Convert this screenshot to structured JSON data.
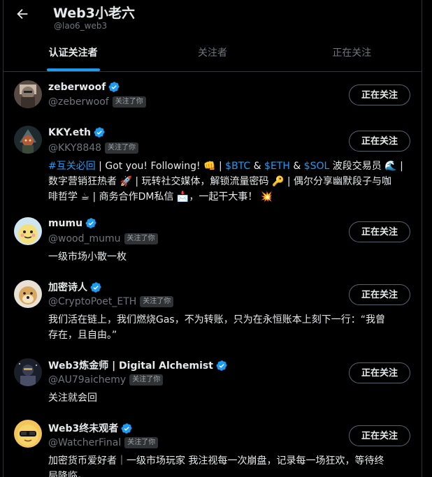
{
  "header": {
    "title": "Web3小老六",
    "handle": "@lao6_web3",
    "back_icon": "arrow-left-icon"
  },
  "tabs": [
    {
      "label": "认证关注者",
      "active": true
    },
    {
      "label": "关注者",
      "active": false
    },
    {
      "label": "正在关注",
      "active": false
    }
  ],
  "users": [
    {
      "name": "zeberwoof",
      "handle": "@zeberwoof",
      "badge": "关注了你",
      "button": "正在关注",
      "bio": []
    },
    {
      "name": "KKY.eth",
      "handle": "@KKY8848",
      "badge": "关注了你",
      "button": "正在关注",
      "bio": [
        "#互关必回 | Got you! Following! 👊 | $BTC & $ETH & $SOL 波段交易员 🌊 |",
        "数字营销狂热者 🚀 | 玩转社交媒体，解锁流量密码 🔑 | 偶尔分享幽默段子与咖",
        "啡哲学 ☕ | 商务合作DM私信 📩，一起干大事！ 💥"
      ]
    },
    {
      "name": "mumu",
      "handle": "@wood_mumu",
      "badge": "关注了你",
      "button": "正在关注",
      "bio": [
        "一级市场小散一枚"
      ]
    },
    {
      "name": "加密诗人",
      "handle": "@CryptoPoet_ETH",
      "badge": "关注了你",
      "button": "正在关注",
      "bio": [
        "我们活在链上，我们燃烧Gas，不为转账，只为在永恒账本上刻下一行：“我曾",
        "存在，且自由。”"
      ]
    },
    {
      "name": "Web3炼金师 | Digital Alchemist",
      "handle": "@AU79aichemy",
      "badge": "关注了你",
      "button": "正在关注",
      "bio": [
        "关注就会回"
      ]
    },
    {
      "name": "Web3终未观者",
      "handle": "@WatcherFinal",
      "badge": "关注了你",
      "button": "正在关注",
      "bio": [
        "加密货币爱好者｜一级市场玩家 我注视每一次崩盘，记录每一场狂欢，等待终",
        "局降临。"
      ]
    }
  ],
  "colors": {
    "accent": "#1d9bf0",
    "background": "#000000",
    "text": "#e7e9ea",
    "muted": "#71767b"
  }
}
